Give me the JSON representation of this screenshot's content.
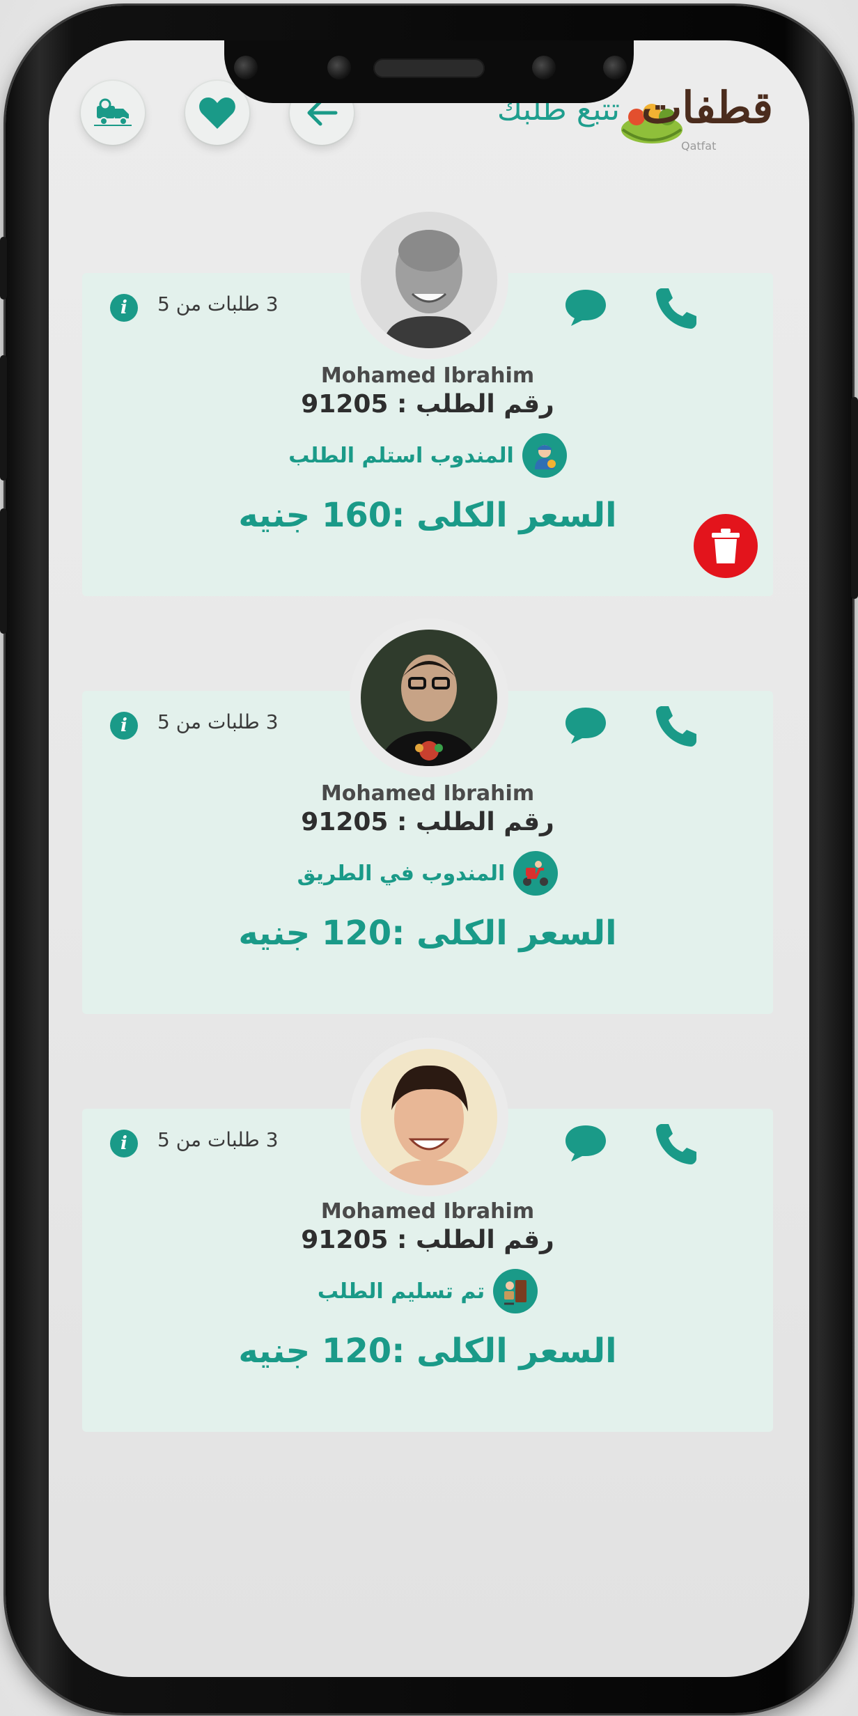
{
  "header": {
    "title": "تتبع طلبك",
    "logo_text": "قطفات",
    "logo_sub": "Qatfat",
    "buttons": [
      "delivery-truck-icon",
      "heart-icon",
      "arrow-left-icon"
    ]
  },
  "colors": {
    "accent": "#1a9a88",
    "card_bg": "#e3f1ec",
    "delete": "#e3141c",
    "logo_brown": "#4b2c1d"
  },
  "orders": [
    {
      "count_text": "3 طلبات من 5",
      "name": "Mohamed Ibrahim",
      "order_number": "رقم الطلب : 91205",
      "status": "المندوب استلم الطلب",
      "status_icon": "courier-icon",
      "total": "السعر الكلى :160 جنيه",
      "has_delete": true
    },
    {
      "count_text": "3 طلبات من 5",
      "name": "Mohamed Ibrahim",
      "order_number": "رقم الطلب : 91205",
      "status": "المندوب في الطريق",
      "status_icon": "scooter-icon",
      "total": "السعر الكلى :120 جنيه",
      "has_delete": false
    },
    {
      "count_text": "3 طلبات من 5",
      "name": "Mohamed Ibrahim",
      "order_number": "رقم الطلب : 91205",
      "status": "تم تسليم الطلب",
      "status_icon": "package-delivered-icon",
      "total": "السعر الكلى :120 جنيه",
      "has_delete": false
    }
  ]
}
